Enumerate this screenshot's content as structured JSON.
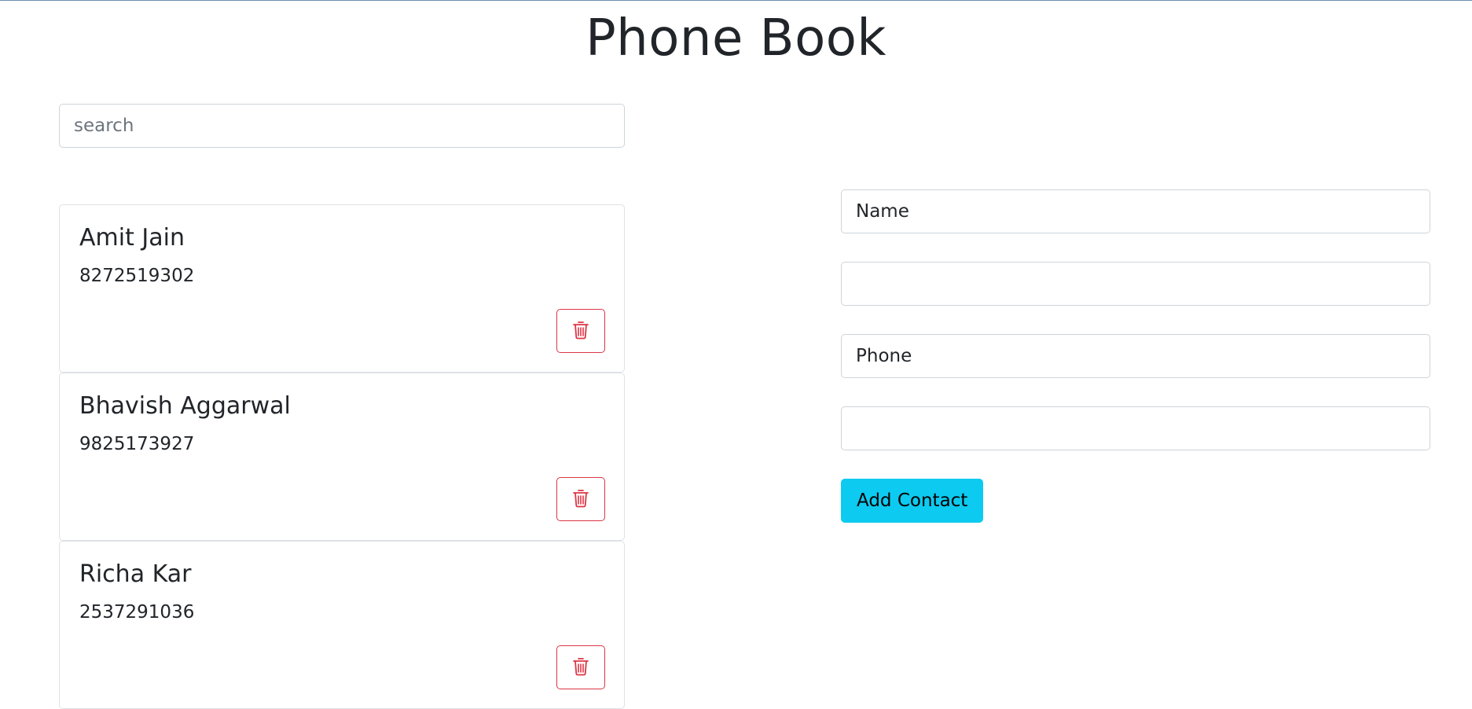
{
  "page": {
    "title": "Phone Book"
  },
  "search": {
    "placeholder": "search",
    "value": ""
  },
  "contacts": [
    {
      "name": "Amit Jain",
      "phone": "8272519302"
    },
    {
      "name": "Bhavish Aggarwal",
      "phone": "9825173927"
    },
    {
      "name": "Richa Kar",
      "phone": "2537291036"
    }
  ],
  "form": {
    "name_value": "Name",
    "name_secondary_value": "",
    "phone_value": "Phone",
    "phone_secondary_value": "",
    "add_button_label": "Add Contact"
  },
  "icons": {
    "delete": "trash-icon"
  },
  "colors": {
    "danger": "#dc3545",
    "info": "#0dcaf0",
    "text": "#212529",
    "border": "#ced4da"
  }
}
